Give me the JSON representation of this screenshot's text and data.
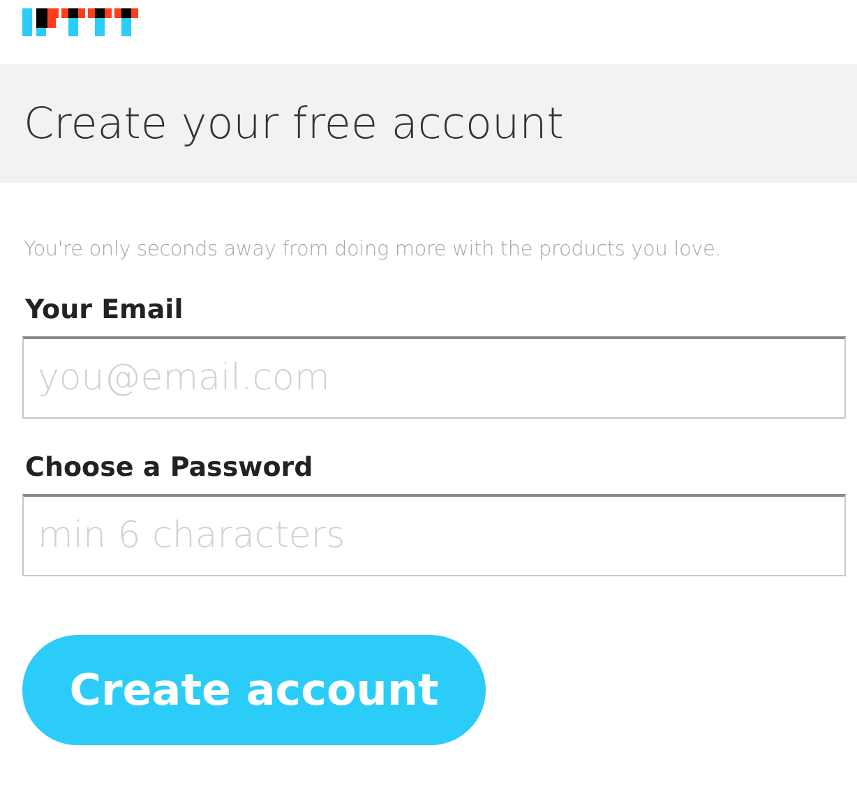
{
  "header": {
    "title": "Create your free account"
  },
  "subtitle": "You're only seconds away from doing more with the products you love.",
  "fields": [
    {
      "label": "Your Email",
      "placeholder": "you@email.com"
    },
    {
      "label": "Choose a Password",
      "placeholder": "min 6 characters"
    }
  ],
  "button": "Create account"
}
